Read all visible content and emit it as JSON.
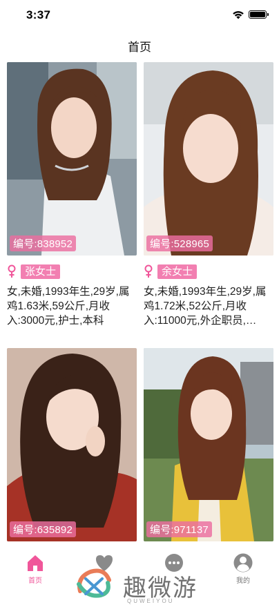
{
  "status_bar": {
    "time": "3:37"
  },
  "header": {
    "title": "首页"
  },
  "cards": [
    {
      "id_label": "编号:838952",
      "name": "张女士",
      "description": "女,未婚,1993年生,29岁,属鸡1.63米,59公斤,月收入:3000元,护士,本科"
    },
    {
      "id_label": "编号:528965",
      "name": "余女士",
      "description": "女,未婚,1993年生,29岁,属鸡1.72米,52公斤,月收入:11000元,外企职员,…"
    },
    {
      "id_label": "编号:635892",
      "name": "",
      "description": ""
    },
    {
      "id_label": "编号:971137",
      "name": "",
      "description": ""
    }
  ],
  "tabbar": {
    "items": [
      {
        "label": "首页",
        "icon": "home-icon",
        "active": true
      },
      {
        "label": "",
        "icon": "heart-icon",
        "active": false
      },
      {
        "label": "",
        "icon": "chat-bubble-icon",
        "active": false
      },
      {
        "label": "我的",
        "icon": "profile-icon",
        "active": false
      }
    ]
  },
  "watermark": {
    "text": "趣微游",
    "sub": "QUWEIYOU"
  },
  "colors": {
    "accent": "#f0569a",
    "badge": "#ec6ea0",
    "tag": "#f27fb1"
  }
}
